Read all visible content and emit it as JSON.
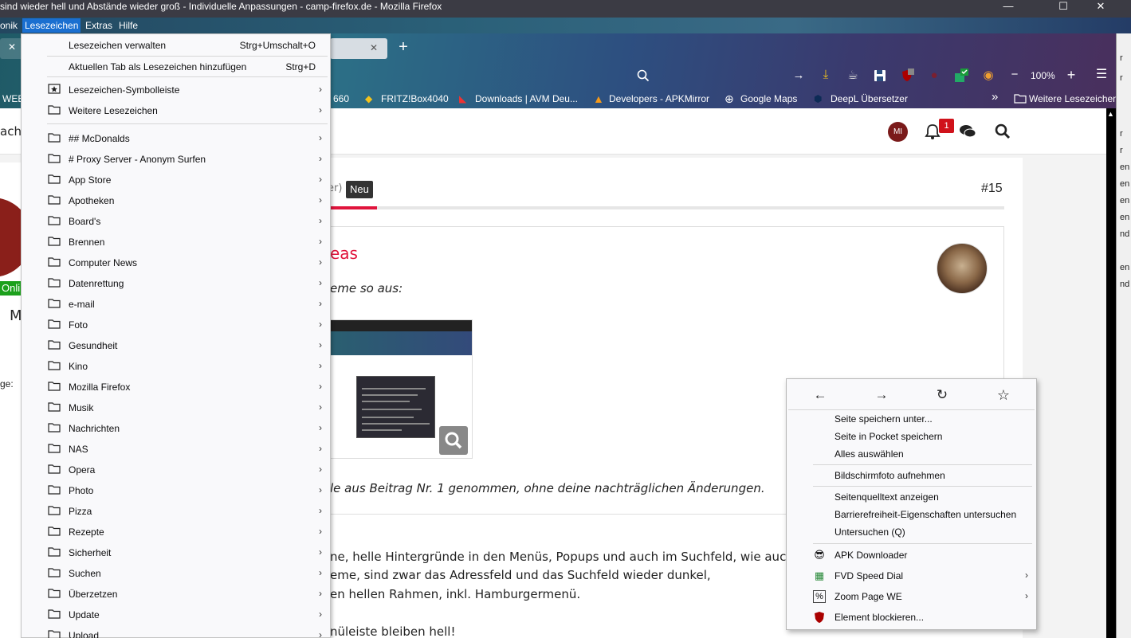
{
  "window": {
    "title": "sind wieder hell und Abstände wieder groß - Individuelle Anpassungen - camp-firefox.de - Mozilla Firefox",
    "minimize": "—",
    "maximize": "☐",
    "close": "✕"
  },
  "menubar": {
    "items": [
      "onik",
      "Lesezeichen",
      "Extras",
      "Hilfe"
    ]
  },
  "toolbar": {
    "new_tab": "+",
    "zoom_minus": "−",
    "zoom": "100%",
    "zoom_plus": "+",
    "menu_icon": "☰"
  },
  "bookmarks_bar": {
    "items": [
      "WEB",
      "660",
      "FRITZ!Box4040",
      "Downloads | AVM Deu...",
      "Developers - APKMirror",
      "Google Maps",
      "DeepL Übersetzer"
    ],
    "more_chevron": "»",
    "more": "Weitere Lesezeichen"
  },
  "site": {
    "left_text": "achr",
    "avatar_initials": "MI",
    "notif_count": "1"
  },
  "post": {
    "header_fragment": "er)",
    "badge": "Neu",
    "number": "#15",
    "author_fragment": "eas",
    "line1": "eme so aus:",
    "line2": "le aus Beitrag Nr. 1 genommen, ohne deine nachträglichen Änderungen.",
    "line3": "ne, helle Hintergründe in den Menüs, Popups und auch im Suchfeld, wie auch",
    "line4": "eme, sind zwar das Adressfeld und das Suchfeld wieder dunkel,",
    "line5": "en hellen Rahmen, inkl. Hamburgermenü.",
    "line6": "nüleiste bleiben hell!",
    "side_online": "Onli",
    "side_m": "M",
    "side_ge": "ge:"
  },
  "bookmarks_menu": {
    "top_items": [
      {
        "label": "Lesezeichen verwalten",
        "shortcut": "Strg+Umschalt+O"
      },
      {
        "label": "Aktuellen Tab als Lesezeichen hinzufügen",
        "shortcut": "Strg+D"
      }
    ],
    "special_items": [
      {
        "label": "Lesezeichen-Symbolleiste",
        "arrow": "›"
      },
      {
        "label": "Weitere Lesezeichen",
        "arrow": "›"
      }
    ],
    "folders": [
      "## McDonalds",
      "# Proxy Server - Anonym Surfen",
      "App Store",
      "Apotheken",
      "Board's",
      "Brennen",
      "Computer News",
      "Datenrettung",
      "e-mail",
      "Foto",
      "Gesundheit",
      "Kino",
      "Mozilla Firefox",
      "Musik",
      "Nachrichten",
      "NAS",
      "Opera",
      "Photo",
      "Pizza",
      "Rezepte",
      "Sicherheit",
      "Suchen",
      "Überzetzen",
      "Update",
      "Upload"
    ],
    "arrow": "›"
  },
  "context_menu": {
    "nav": [
      "←",
      "→",
      "↻",
      "☆"
    ],
    "group1": [
      "Seite speichern unter...",
      "Seite in Pocket speichern",
      "Alles auswählen"
    ],
    "group2": [
      "Bildschirmfoto aufnehmen"
    ],
    "group3": [
      "Seitenquelltext anzeigen",
      "Barrierefreiheit-Eigenschaften untersuchen",
      "Untersuchen (Q)"
    ],
    "extensions": [
      {
        "label": "APK Downloader",
        "icon": "😎",
        "arrow": ""
      },
      {
        "label": "FVD Speed Dial",
        "icon": "▦",
        "arrow": "›"
      },
      {
        "label": "Zoom Page WE",
        "icon": "%",
        "arrow": "›"
      },
      {
        "label": "Element blockieren...",
        "icon": "uo",
        "arrow": ""
      }
    ]
  },
  "colors": {
    "accent_red": "#e0143c",
    "badge_dark": "#333333",
    "menu_highlight": "#1a6fd0",
    "online_green": "#1ca01c"
  }
}
